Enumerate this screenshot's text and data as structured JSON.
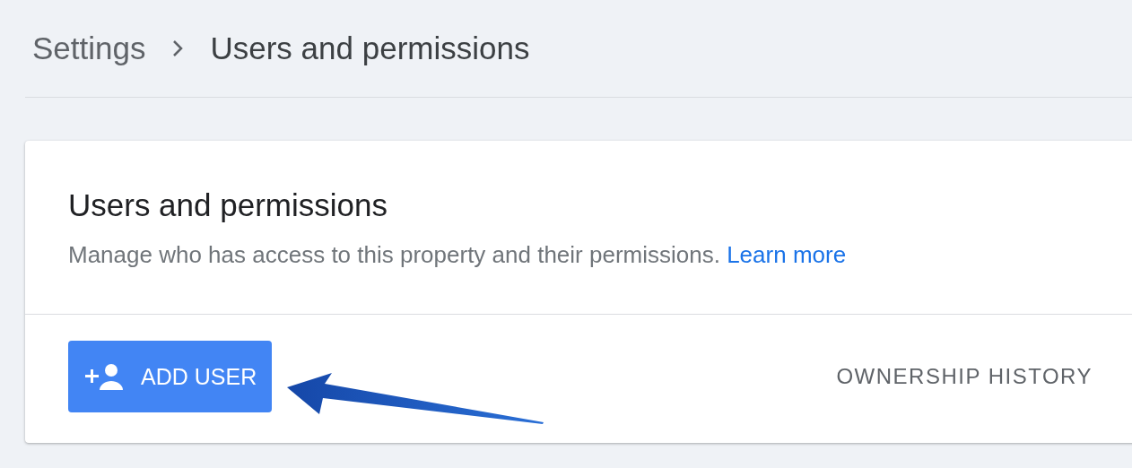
{
  "breadcrumb": [
    {
      "label": "Settings"
    },
    {
      "label": "Users and permissions"
    }
  ],
  "card": {
    "title": "Users and permissions",
    "description": "Manage who has access to this property and their permissions.",
    "link": "Learn more",
    "actions": [
      {
        "kind": "primary",
        "label": "ADD USER"
      },
      {
        "kind": "text",
        "label": "OWNERSHIP HISTORY"
      }
    ]
  }
}
